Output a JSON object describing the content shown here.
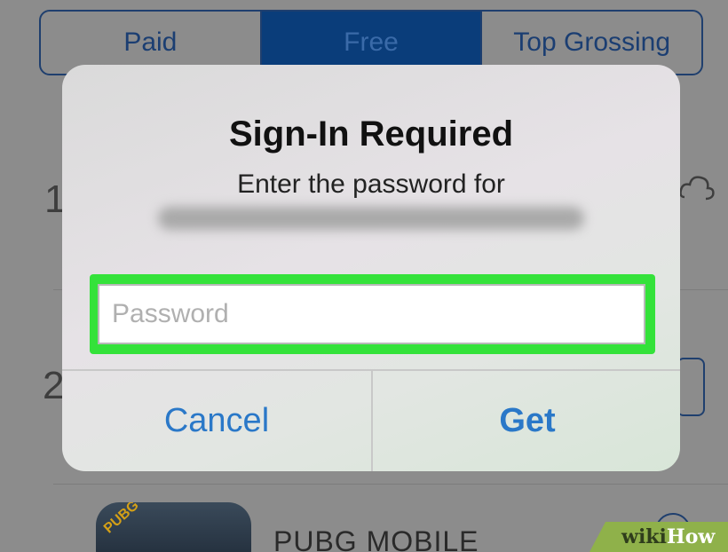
{
  "segmented_control": {
    "tabs": [
      {
        "label": "Paid",
        "active": false
      },
      {
        "label": "Free",
        "active": true
      },
      {
        "label": "Top Grossing",
        "active": false
      }
    ]
  },
  "background_list": {
    "ranks": [
      "1",
      "2"
    ],
    "app_name": "PUBG MOBILE",
    "app_icon_badge": "PUBG",
    "icons": [
      "cloud-download-icon",
      "info-icon"
    ]
  },
  "dialog": {
    "title": "Sign-In Required",
    "message": "Enter the password for",
    "account_text": "",
    "password_placeholder": "Password",
    "password_value": "",
    "cancel_label": "Cancel",
    "get_label": "Get"
  },
  "watermark": {
    "text_wiki": "wiki",
    "text_how": "How"
  },
  "colors": {
    "accent_blue": "#2a78c8",
    "highlight_green": "#34e23a",
    "segment_active": "#0a3d7a"
  }
}
